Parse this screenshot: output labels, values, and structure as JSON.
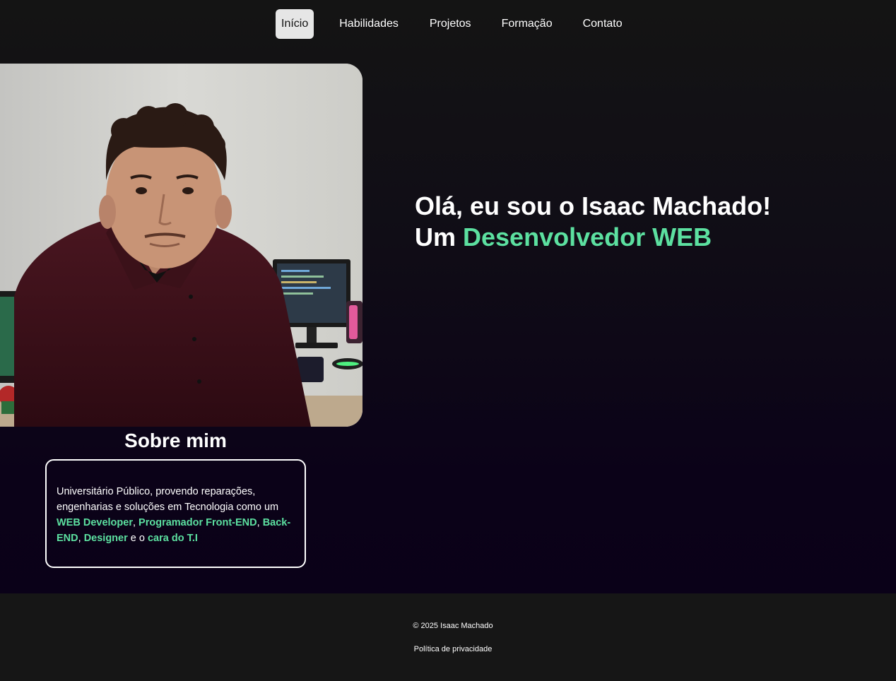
{
  "nav": {
    "items": [
      {
        "label": "Início",
        "active": true
      },
      {
        "label": "Habilidades",
        "active": false
      },
      {
        "label": "Projetos",
        "active": false
      },
      {
        "label": "Formação",
        "active": false
      },
      {
        "label": "Contato",
        "active": false
      }
    ]
  },
  "hero": {
    "line1": "Olá, eu sou o Isaac Machado!",
    "line2_prefix": "Um ",
    "line2_accent": "Desenvolvedor WEB"
  },
  "about": {
    "title": "Sobre mim",
    "text_1": "Universitário Público, provendo reparações, engenharias e soluções em Tecnologia como um ",
    "hl_1": "WEB Developer",
    "sep_1": ", ",
    "hl_2": "Programador Front-END",
    "sep_2": ", ",
    "hl_3": "Back-END",
    "sep_3": ", ",
    "hl_4": "Designer",
    "text_2": " e o ",
    "hl_5": "cara do T.I"
  },
  "footer": {
    "copyright": "© 2025 Isaac Machado",
    "privacy": "Política de privacidade"
  },
  "colors": {
    "accent": "#5ce0a0",
    "nav_active_bg": "#e6e6e6",
    "footer_bg": "#161616",
    "page_bg_bottom": "#0a0018"
  }
}
